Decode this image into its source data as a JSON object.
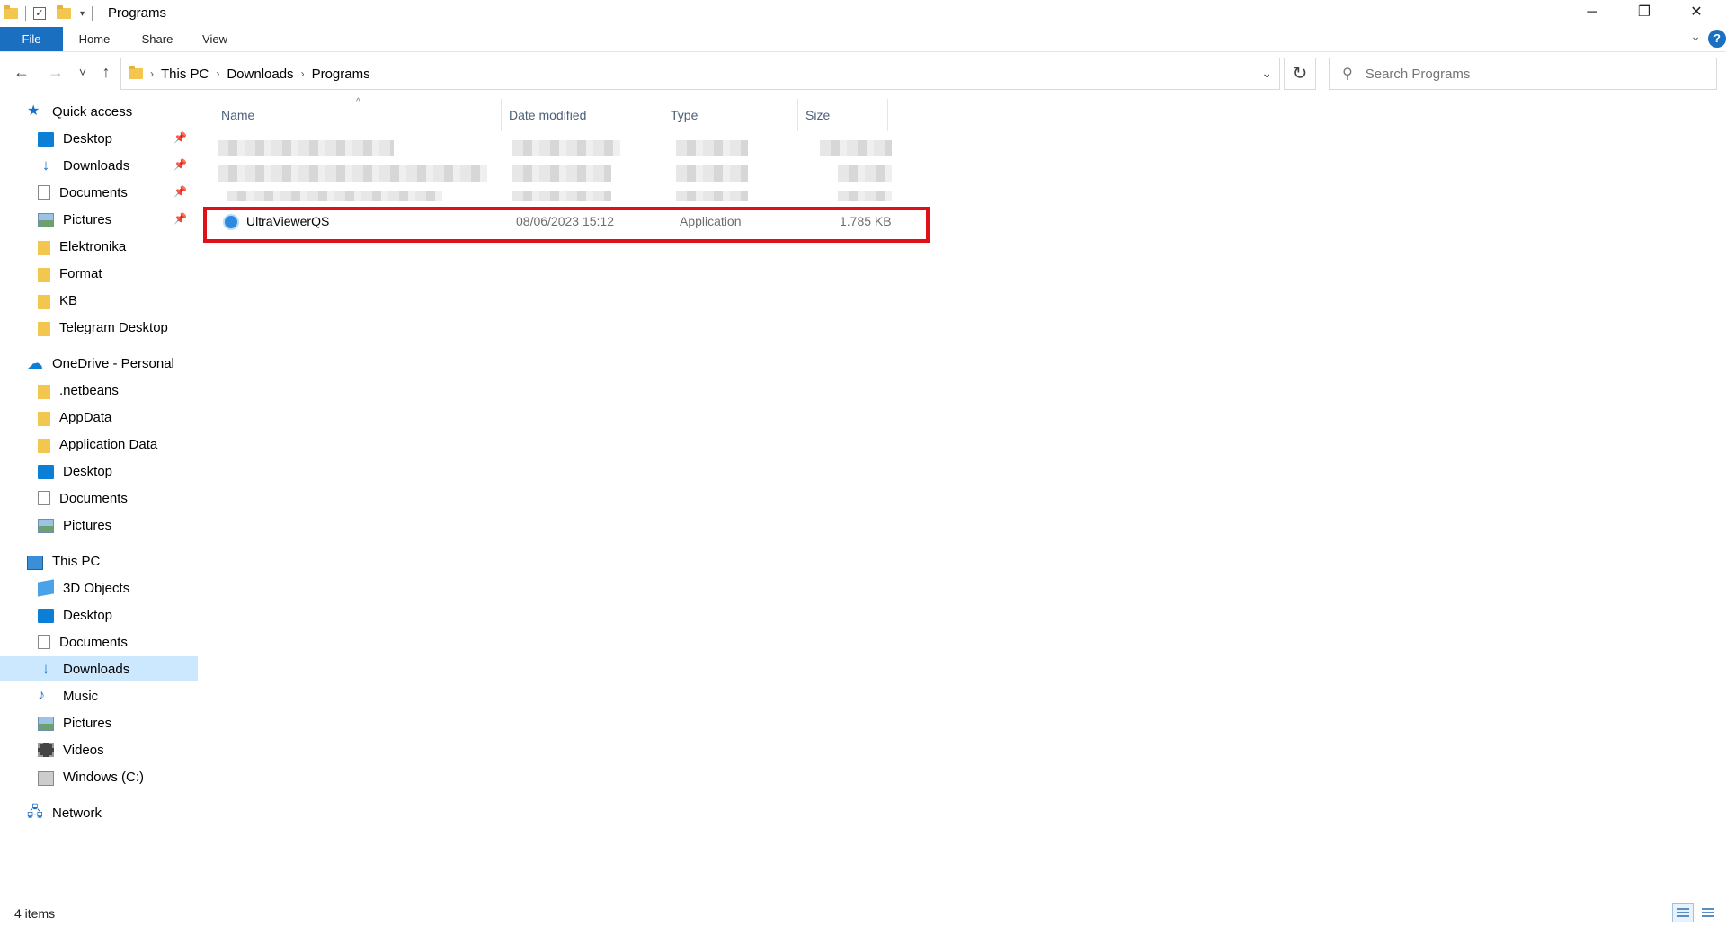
{
  "window": {
    "title": "Programs",
    "minimize_glyph": "─",
    "maximize_glyph": "❐",
    "close_glyph": "✕"
  },
  "ribbon": {
    "tabs": [
      "File",
      "Home",
      "Share",
      "View"
    ],
    "help_glyph": "?"
  },
  "navigation": {
    "back_glyph": "←",
    "forward_glyph": "→",
    "recent_glyph": "˅",
    "up_glyph": "↑",
    "breadcrumb": [
      "This PC",
      "Downloads",
      "Programs"
    ],
    "refresh_glyph": "↻",
    "search_placeholder": "Search Programs"
  },
  "sidebar": {
    "quick_access": {
      "label": "Quick access",
      "items": [
        {
          "label": "Desktop",
          "icon": "desktop-icon",
          "pinned": true
        },
        {
          "label": "Downloads",
          "icon": "downloads-icon",
          "pinned": true
        },
        {
          "label": "Documents",
          "icon": "documents-icon",
          "pinned": true
        },
        {
          "label": "Pictures",
          "icon": "pictures-icon",
          "pinned": true
        },
        {
          "label": "Elektronika",
          "icon": "folder-icon"
        },
        {
          "label": "Format",
          "icon": "folder-icon"
        },
        {
          "label": "KB",
          "icon": "folder-icon"
        },
        {
          "label": "Telegram Desktop",
          "icon": "folder-icon"
        }
      ]
    },
    "onedrive": {
      "label": "OneDrive - Personal",
      "items": [
        {
          "label": ".netbeans",
          "icon": "folder-icon"
        },
        {
          "label": "AppData",
          "icon": "folder-icon"
        },
        {
          "label": "Application Data",
          "icon": "folder-icon"
        },
        {
          "label": "Desktop",
          "icon": "desktop-icon"
        },
        {
          "label": "Documents",
          "icon": "documents-icon"
        },
        {
          "label": "Pictures",
          "icon": "pictures-icon"
        }
      ]
    },
    "this_pc": {
      "label": "This PC",
      "items": [
        {
          "label": "3D Objects",
          "icon": "3d-objects-icon"
        },
        {
          "label": "Desktop",
          "icon": "desktop-icon"
        },
        {
          "label": "Documents",
          "icon": "documents-icon"
        },
        {
          "label": "Downloads",
          "icon": "downloads-icon",
          "selected": true
        },
        {
          "label": "Music",
          "icon": "music-icon"
        },
        {
          "label": "Pictures",
          "icon": "pictures-icon"
        },
        {
          "label": "Videos",
          "icon": "videos-icon"
        },
        {
          "label": "Windows (C:)",
          "icon": "drive-icon"
        }
      ]
    },
    "network": {
      "label": "Network"
    }
  },
  "file_list": {
    "columns": [
      "Name",
      "Date modified",
      "Type",
      "Size"
    ],
    "highlighted_file": {
      "name": "UltraViewerQS",
      "date_modified": "08/06/2023 15:12",
      "type": "Application",
      "size": "1.785 KB"
    },
    "highlight_color": "#e0101b"
  },
  "status": {
    "item_count": "4 items"
  }
}
